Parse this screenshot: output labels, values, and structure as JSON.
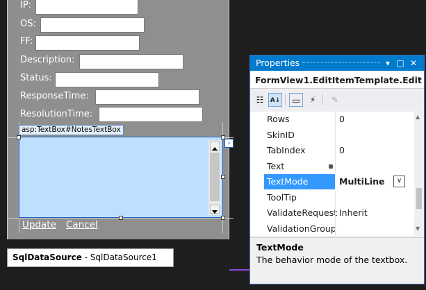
{
  "form": {
    "labels": {
      "ip": "IP:",
      "os": "OS:",
      "ff": "FF:",
      "description": "Description:",
      "status": "Status:",
      "response_time": "ResponseTime:",
      "resolution_time": "ResolutionTime:"
    },
    "notes_tag": "asp:TextBox#NotesTextBox",
    "update_link": "Update",
    "cancel_link": "Cancel"
  },
  "datasource": {
    "type": "SqlDataSource",
    "separator": " - ",
    "name": "SqlDataSource1"
  },
  "properties": {
    "title": "Properties",
    "object": "FormView1.EditItemTemplate.Edit",
    "rows": [
      {
        "name": "Rows",
        "value": "0"
      },
      {
        "name": "SkinID",
        "value": ""
      },
      {
        "name": "TabIndex",
        "value": "0"
      },
      {
        "name": "Text",
        "value": ""
      },
      {
        "name": "TextMode",
        "value": "MultiLine",
        "selected": true
      },
      {
        "name": "ToolTip",
        "value": ""
      },
      {
        "name": "ValidateRequest",
        "value": "Inherit"
      },
      {
        "name": "ValidationGroup",
        "value": ""
      }
    ],
    "desc_title": "TextMode",
    "desc_text": "The behavior mode of the textbox."
  },
  "colors": {
    "accent": "#007acc",
    "selection": "#3399ff",
    "textbox_selected": "#bfdfff",
    "designer_bg": "#8f8f8f"
  }
}
